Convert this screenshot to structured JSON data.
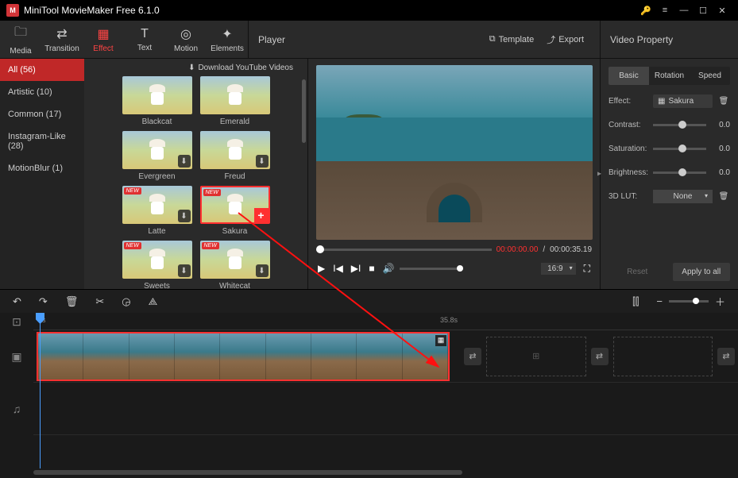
{
  "titlebar": {
    "title": "MiniTool MovieMaker Free 6.1.0"
  },
  "toptabs": {
    "media": "Media",
    "transition": "Transition",
    "effect": "Effect",
    "text": "Text",
    "motion": "Motion",
    "elements": "Elements"
  },
  "playerheader": {
    "title": "Player",
    "template": "Template",
    "export": "Export"
  },
  "propheader": "Video Property",
  "categories": [
    {
      "label": "All (56)",
      "active": true
    },
    {
      "label": "Artistic (10)"
    },
    {
      "label": "Common (17)"
    },
    {
      "label": "Instagram-Like (28)"
    },
    {
      "label": "MotionBlur (1)"
    }
  ],
  "download_yt": "Download YouTube Videos",
  "effects": [
    {
      "name": "Blackcat",
      "new": false,
      "dl": false
    },
    {
      "name": "Emerald",
      "new": false,
      "dl": false
    },
    {
      "name": "Evergreen",
      "new": false,
      "dl": true
    },
    {
      "name": "Freud",
      "new": false,
      "dl": true
    },
    {
      "name": "Latte",
      "new": true,
      "dl": true
    },
    {
      "name": "Sakura",
      "new": true,
      "selected": true,
      "add": true
    },
    {
      "name": "Sweets",
      "new": true,
      "dl": true
    },
    {
      "name": "Whitecat",
      "new": true,
      "dl": true
    }
  ],
  "player": {
    "current": "00:00:00.00",
    "duration": "00:00:35.19",
    "ratio": "16:9"
  },
  "props": {
    "tabs": {
      "basic": "Basic",
      "rotation": "Rotation",
      "speed": "Speed"
    },
    "effect_label": "Effect:",
    "effect_value": "Sakura",
    "contrast_label": "Contrast:",
    "contrast_value": "0.0",
    "saturation_label": "Saturation:",
    "saturation_value": "0.0",
    "brightness_label": "Brightness:",
    "brightness_value": "0.0",
    "lut_label": "3D LUT:",
    "lut_value": "None",
    "reset": "Reset",
    "apply": "Apply to all"
  },
  "timeline": {
    "tick0": "0s",
    "tick1": "35.8s"
  }
}
